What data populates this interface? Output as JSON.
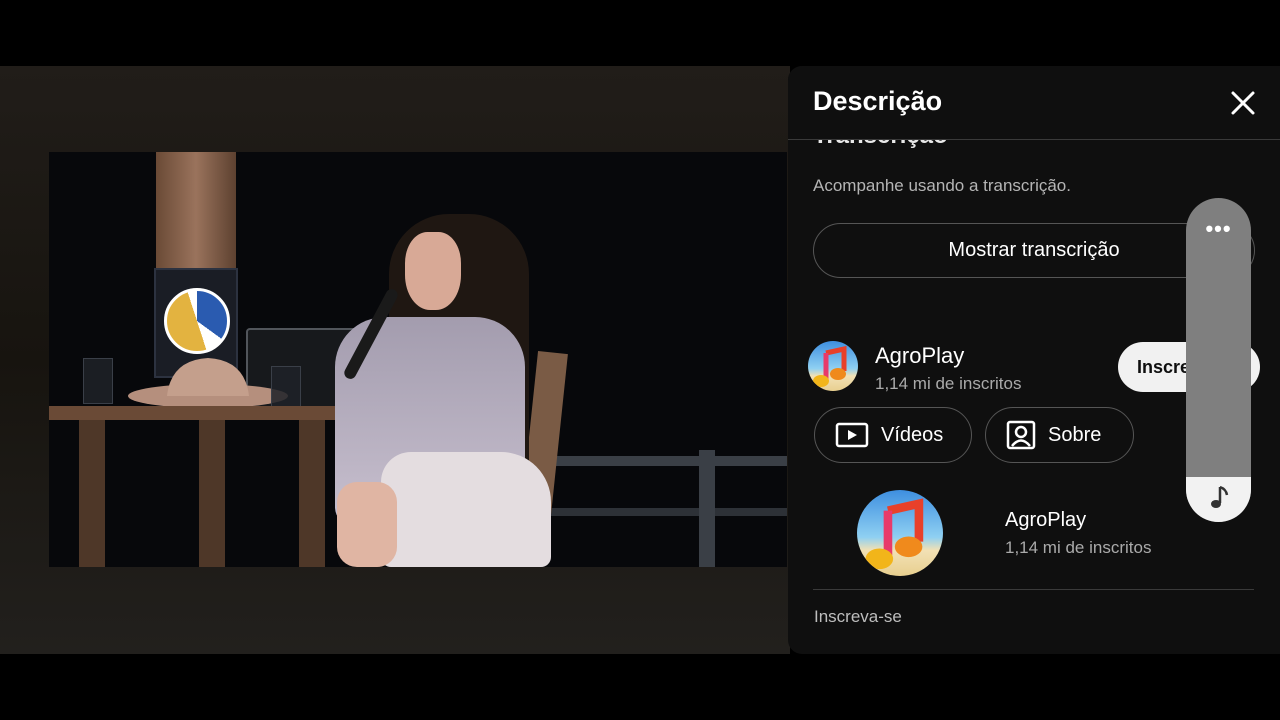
{
  "panel": {
    "title": "Descrição",
    "peek_title": "Transcrição",
    "transcript_desc": "Acompanhe usando a transcrição.",
    "show_transcript_label": "Mostrar transcrição",
    "channel": {
      "name": "AgroPlay",
      "subscribers": "1,14 mi de inscritos",
      "subscribe_label": "Inscre"
    },
    "videos_label": "Vídeos",
    "about_label": "Sobre",
    "channel_card": {
      "name": "AgroPlay",
      "subscribers": "1,14 mi de inscritos"
    },
    "bottom_link": "Inscreva-se"
  },
  "overlay": {
    "dots": "•••"
  },
  "colors": {
    "panel_bg": "#0f0f0f",
    "subscribe_bg": "#f1f1f1",
    "overlay_bar": "#7f7f7f"
  },
  "icons": [
    "close-icon",
    "play-box-icon",
    "person-box-icon",
    "music-note-icon",
    "more-dots-icon"
  ]
}
